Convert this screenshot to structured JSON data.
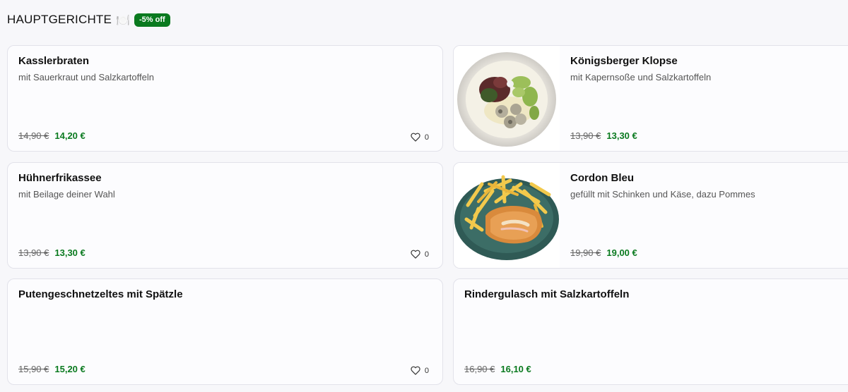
{
  "section": {
    "title": "HAUPTGERICHTE",
    "emoji": "🍽️",
    "badge": "-5% off"
  },
  "dishes": [
    {
      "name": "Kasslerbraten",
      "description": "mit Sauerkraut und Salzkartoffeln",
      "old_price": "14,90 €",
      "new_price": "14,20 €",
      "likes": "0",
      "image": null
    },
    {
      "name": "Königsberger Klopse",
      "description": "mit Kapernsoße und Salzkartoffeln",
      "old_price": "13,90 €",
      "new_price": "13,30 €",
      "likes": null,
      "image": "plate-meatballs"
    },
    {
      "name": "Hühnerfrikassee",
      "description": "mit Beilage deiner Wahl",
      "old_price": "13,90 €",
      "new_price": "13,30 €",
      "likes": "0",
      "image": null
    },
    {
      "name": "Cordon Bleu",
      "description": "gefüllt mit Schinken und Käse, dazu Pommes",
      "old_price": "19,90 €",
      "new_price": "19,00 €",
      "likes": null,
      "image": "plate-cordon-bleu-fries"
    },
    {
      "name": "Putengeschnetzeltes mit Spätzle",
      "description": "",
      "old_price": "15,90 €",
      "new_price": "15,20 €",
      "likes": "0",
      "image": null
    },
    {
      "name": "Rindergulasch mit Salzkartoffeln",
      "description": "",
      "old_price": "16,90 €",
      "new_price": "16,10 €",
      "likes": null,
      "image": null
    }
  ],
  "colors": {
    "accent_green": "#0a7a1f",
    "card_border": "#e2e2ea",
    "background": "#f7f7fa"
  }
}
